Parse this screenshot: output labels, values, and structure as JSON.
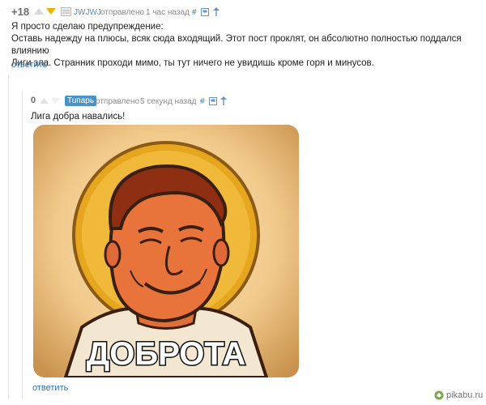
{
  "comment1": {
    "rating": "+18",
    "author": "JWJWJ",
    "posted_label": "отправлено",
    "time": "1 час назад",
    "link_hash": "#",
    "text_lines": [
      "Я просто сделаю предупреждение:",
      "Оставь надежду на плюсы, всяк сюда входящий. Этот пост проклят, он абсолютно полностью поддался влиянию",
      "Лиги зла. Странник проходи мимо, ты тут ничего не увидишь кроме горя и минусов."
    ],
    "reply": "ответить"
  },
  "comment2": {
    "rating": "0",
    "author": "Tuпарь",
    "posted_label": "отправлено",
    "time": "5 секунд назад",
    "link_hash": "#",
    "text": "Лига добра навались!",
    "image_caption": "ДОБРОТА",
    "reply": "ответить"
  },
  "watermark": "pikabu.ru",
  "colors": {
    "link": "#2f72b6",
    "badge": "#4b93c5",
    "downvote": "#e8b400"
  },
  "icons": [
    "up-arrow-icon",
    "down-arrow-icon",
    "avatar-icon",
    "save-icon",
    "parent-arrow-icon",
    "pikabu-logo-icon"
  ]
}
